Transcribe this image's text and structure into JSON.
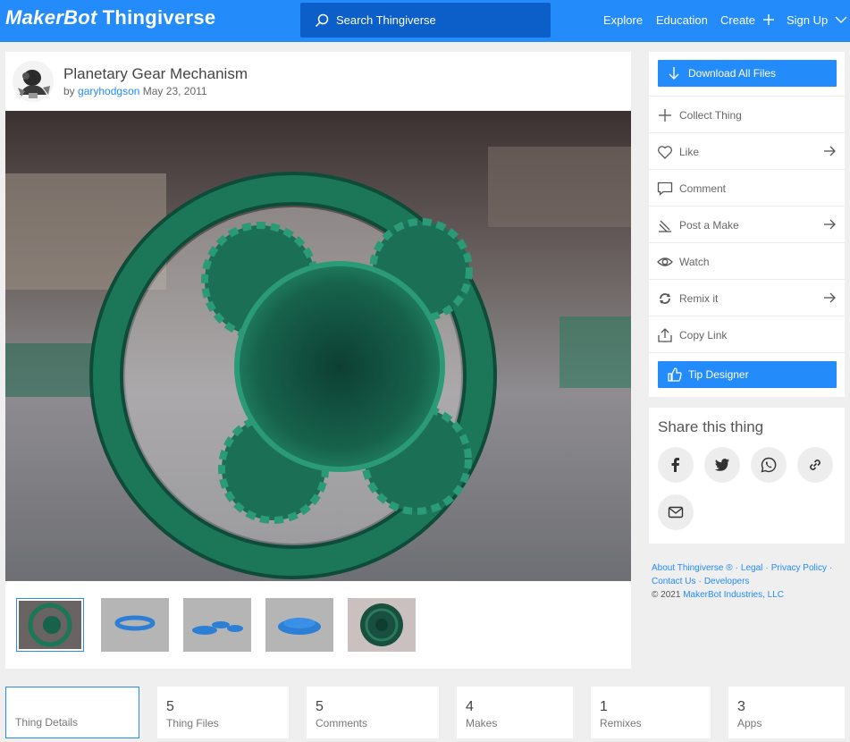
{
  "header": {
    "logo_maker": "MakerBot",
    "logo_thing": "Thingiverse",
    "search_placeholder": "Search Thingiverse",
    "nav": {
      "explore": "Explore",
      "education": "Education",
      "create": "Create",
      "signup": "Sign Up"
    },
    "brand_color": "#248bfb"
  },
  "thing": {
    "title": "Planetary Gear Mechanism",
    "by": "by",
    "author": "garyhodgson",
    "date": "May 23, 2011",
    "thumbnail_count": 5
  },
  "actions": {
    "download": "Download All Files",
    "collect": "Collect Thing",
    "like": "Like",
    "comment": "Comment",
    "post_make": "Post a Make",
    "watch": "Watch",
    "remix": "Remix it",
    "copy_link": "Copy Link",
    "tip": "Tip Designer"
  },
  "share": {
    "title": "Share this thing",
    "icons": [
      "facebook-icon",
      "twitter-icon",
      "whatsapp-icon",
      "link-icon",
      "email-icon"
    ]
  },
  "footer": {
    "about": "About Thingiverse ®",
    "legal": "Legal",
    "privacy": "Privacy Policy",
    "contact": "Contact Us",
    "developers": "Developers",
    "copyright": "©  2021",
    "company": "MakerBot Industries, LLC"
  },
  "tabs": [
    {
      "count": "",
      "label": "Thing Details"
    },
    {
      "count": "5",
      "label": "Thing Files"
    },
    {
      "count": "5",
      "label": "Comments"
    },
    {
      "count": "4",
      "label": "Makes"
    },
    {
      "count": "1",
      "label": "Remixes"
    },
    {
      "count": "3",
      "label": "Apps"
    }
  ]
}
